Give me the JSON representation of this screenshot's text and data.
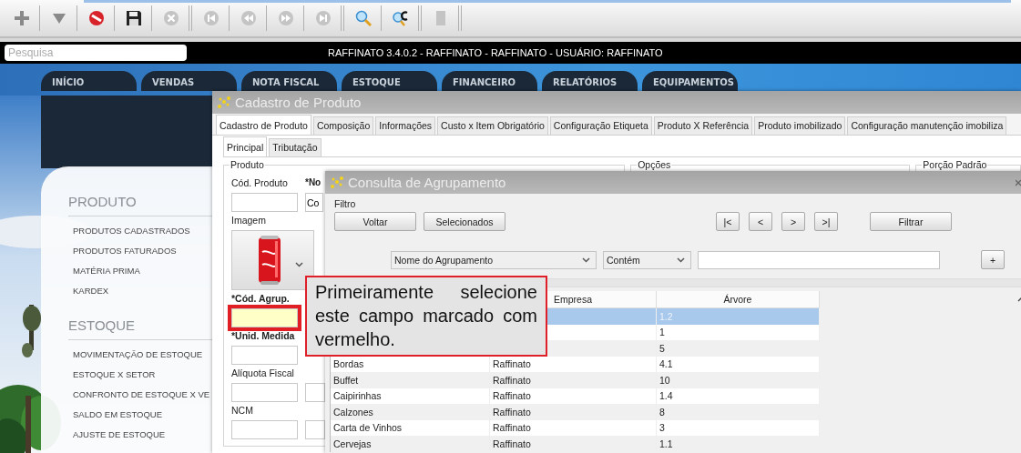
{
  "toolbar": {
    "buttons": [
      {
        "kind": "add",
        "disabled": false
      },
      {
        "kind": "dropdown",
        "disabled": false
      },
      {
        "kind": "stop",
        "disabled": false
      },
      {
        "kind": "save",
        "disabled": false
      },
      {
        "kind": "cancel",
        "disabled": true,
        "group_end": true
      },
      {
        "kind": "first",
        "disabled": true
      },
      {
        "kind": "previous",
        "disabled": true
      },
      {
        "kind": "next",
        "disabled": true
      },
      {
        "kind": "last",
        "disabled": true,
        "group_end": true
      },
      {
        "kind": "search",
        "disabled": false
      },
      {
        "kind": "search_code",
        "disabled": false,
        "group_end": true
      },
      {
        "kind": "exit",
        "disabled": true,
        "group_end": true
      }
    ]
  },
  "search": {
    "placeholder": "Pesquisa"
  },
  "app_title": "RAFFINATO 3.4.0.2 - RAFFINATO - RAFFINATO - USUÁRIO: RAFFINATO",
  "nav_tabs": [
    "INÍCIO",
    "VENDAS",
    "NOTA FISCAL",
    "ESTOQUE",
    "FINANCEIRO",
    "RELATÓRIOS",
    "EQUIPAMENTOS"
  ],
  "sidebar": {
    "sections": [
      {
        "title": "PRODUTO",
        "items": [
          "PRODUTOS CADASTRADOS",
          "PRODUTOS FATURADOS",
          "MATÉRIA PRIMA",
          "KARDEX"
        ]
      },
      {
        "title": "ESTOQUE",
        "items": [
          "MOVIMENTAÇÃO DE ESTOQUE",
          "ESTOQUE X SETOR",
          "CONFRONTO DE ESTOQUE X VE",
          "SALDO EM ESTOQUE",
          "AJUSTE DE ESTOQUE"
        ]
      }
    ]
  },
  "product_window": {
    "title": "Cadastro de Produto",
    "tabs": [
      {
        "label": "Cadastro de Produto",
        "selected": true
      },
      {
        "label": "Composição",
        "selected": false
      },
      {
        "label": "Informações",
        "selected": false
      },
      {
        "label": "Custo x Item Obrigatório",
        "selected": false
      },
      {
        "label": "Configuração Etiqueta",
        "selected": false
      },
      {
        "label": "Produto X Referência",
        "selected": false
      },
      {
        "label": "Produto imobilizado",
        "selected": false
      },
      {
        "label": "Configuração manutenção imobiliza",
        "selected": false
      }
    ],
    "subtabs": [
      {
        "label": "Principal",
        "selected": true
      },
      {
        "label": "Tributação",
        "selected": false
      }
    ],
    "groups": [
      "Produto",
      "Opções",
      "Porção Padrão"
    ],
    "fields": [
      {
        "kind": "text",
        "label": "Cód. Produto",
        "required": false,
        "highlighted": false,
        "extra_box": false
      },
      {
        "label": "Imagem",
        "required": false,
        "highlighted": false,
        "extra_box": false
      },
      {
        "kind": "text",
        "label": "*Cód. Agrup.",
        "required": true,
        "highlighted": true,
        "extra_box": false
      },
      {
        "kind": "text",
        "label": "*Unid. Medida",
        "required": true,
        "highlighted": false,
        "extra_box": false
      },
      {
        "kind": "text",
        "label": "Alíquota Fiscal",
        "required": false,
        "highlighted": false,
        "extra_box": true
      },
      {
        "kind": "text",
        "label": "NCM",
        "required": false,
        "highlighted": false,
        "extra_box": true
      }
    ],
    "name_field": {
      "label": "*No",
      "value": "Co"
    }
  },
  "lookup_window": {
    "title": "Consulta de Agrupamento",
    "filter_title": "Filtro",
    "buttons": [
      "Voltar",
      "Selecionados"
    ],
    "pager": [
      "|<",
      "<",
      ">",
      ">|"
    ],
    "filter_button": "Filtrar",
    "filter_field": "Nome do Agrupamento",
    "operator": "Contém",
    "add_button": "+",
    "columns": [
      "Empresa",
      "Árvore"
    ],
    "rows": [
      {
        "tree": "1.2",
        "selected": true
      },
      {
        "tree": "1",
        "selected": false
      },
      {
        "tree": "5",
        "selected": false
      },
      {
        "name": "Bordas",
        "company": "Raffinato",
        "tree": "4.1",
        "selected": false
      },
      {
        "name": "Buffet",
        "company": "Raffinato",
        "tree": "10",
        "selected": false
      },
      {
        "name": "Caipirinhas",
        "company": "Raffinato",
        "tree": "1.4",
        "selected": false
      },
      {
        "name": "Calzones",
        "company": "Raffinato",
        "tree": "8",
        "selected": false
      },
      {
        "name": "Carta de Vinhos",
        "company": "Raffinato",
        "tree": "3",
        "selected": false
      },
      {
        "name": "Cervejas",
        "company": "Raffinato",
        "tree": "1.1",
        "selected": false
      }
    ]
  },
  "callout": "Primeiramente selecione este campo marcado com vermelho."
}
